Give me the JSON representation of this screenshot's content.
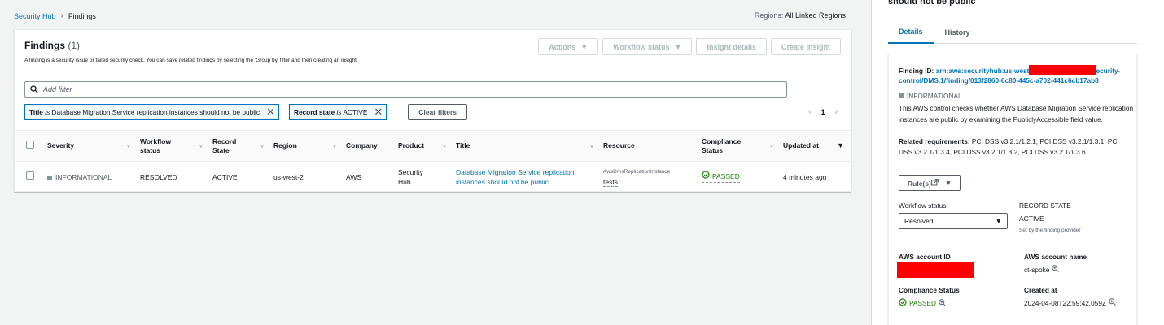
{
  "breadcrumb": {
    "root": "Security Hub",
    "current": "Findings"
  },
  "regions": {
    "label": "Regions:",
    "value": "All Linked Regions"
  },
  "findings": {
    "title": "Findings",
    "count": "(1)",
    "description": "A finding is a security issue or failed security check. You can save related findings by selecting the 'Group by' filter and then creating an insight.",
    "actions": {
      "actions": "Actions",
      "workflow_status": "Workflow status",
      "insight_details": "Insight details",
      "create_insight": "Create insight"
    },
    "search_placeholder": "Add filter",
    "filters": [
      {
        "key": "Title",
        "op": "is",
        "value": "Database Migration Service replication instances should not be public"
      },
      {
        "key": "Record state",
        "op": "is",
        "value": "ACTIVE"
      }
    ],
    "clear_filters": "Clear filters",
    "page": "1",
    "columns": {
      "severity": "Severity",
      "workflow_status": "Workflow status",
      "record_state": "Record State",
      "region": "Region",
      "company": "Company",
      "product": "Product",
      "title": "Title",
      "resource": "Resource",
      "compliance_status": "Compliance Status",
      "updated_at": "Updated at"
    },
    "rows": [
      {
        "severity": "INFORMATIONAL",
        "workflow_status": "RESOLVED",
        "record_state": "ACTIVE",
        "region": "us-west-2",
        "company": "AWS",
        "product": "Security Hub",
        "title": "Database Migration Service replication instances should not be public",
        "resource_type": "AwsDmsReplicationInstance",
        "resource_id": "tests",
        "compliance_status": "PASSED",
        "updated_at": "4 minutes ago"
      }
    ]
  },
  "detail": {
    "title": "should not be public",
    "tabs": [
      "Details",
      "History"
    ],
    "finding_id_label": "Finding ID:",
    "finding_id_start": "arn:aws:securityhub:us-west",
    "finding_id_end": "ecurity-",
    "finding_id_line2": "control/DMS.1/finding/013f2860-6c80-445c-a702-441c6cb17ab8",
    "severity": "INFORMATIONAL",
    "description": "This AWS control checks whether AWS Database Migration Service replication instances are public by examining the PubliclyAccessible field value.",
    "requirements_label": "Related requirements:",
    "requirements": "PCI DSS v3.2.1/1.2.1, PCI DSS v3.2.1/1.3.1, PCI DSS v3.2.1/1.3.4, PCI DSS v3.2.1/1.3.2, PCI DSS v3.2.1/1.3.6",
    "rules_button": "Rule(s)",
    "workflow_status_label": "Workflow status",
    "workflow_status_value": "Resolved",
    "record_state_label": "RECORD STATE",
    "record_state_value": "ACTIVE",
    "record_state_note": "Set by the finding provider",
    "aws_account_id_label": "AWS account ID",
    "aws_account_name_label": "AWS account name",
    "aws_account_name": "ct-spoke",
    "compliance_status_label": "Compliance Status",
    "compliance_status": "PASSED",
    "created_at_label": "Created at",
    "created_at": "2024-04-08T22:59:42.059Z"
  },
  "colors": {
    "link": "#0073bb",
    "passed": "#1d8102",
    "redaction": "#ff0000"
  }
}
